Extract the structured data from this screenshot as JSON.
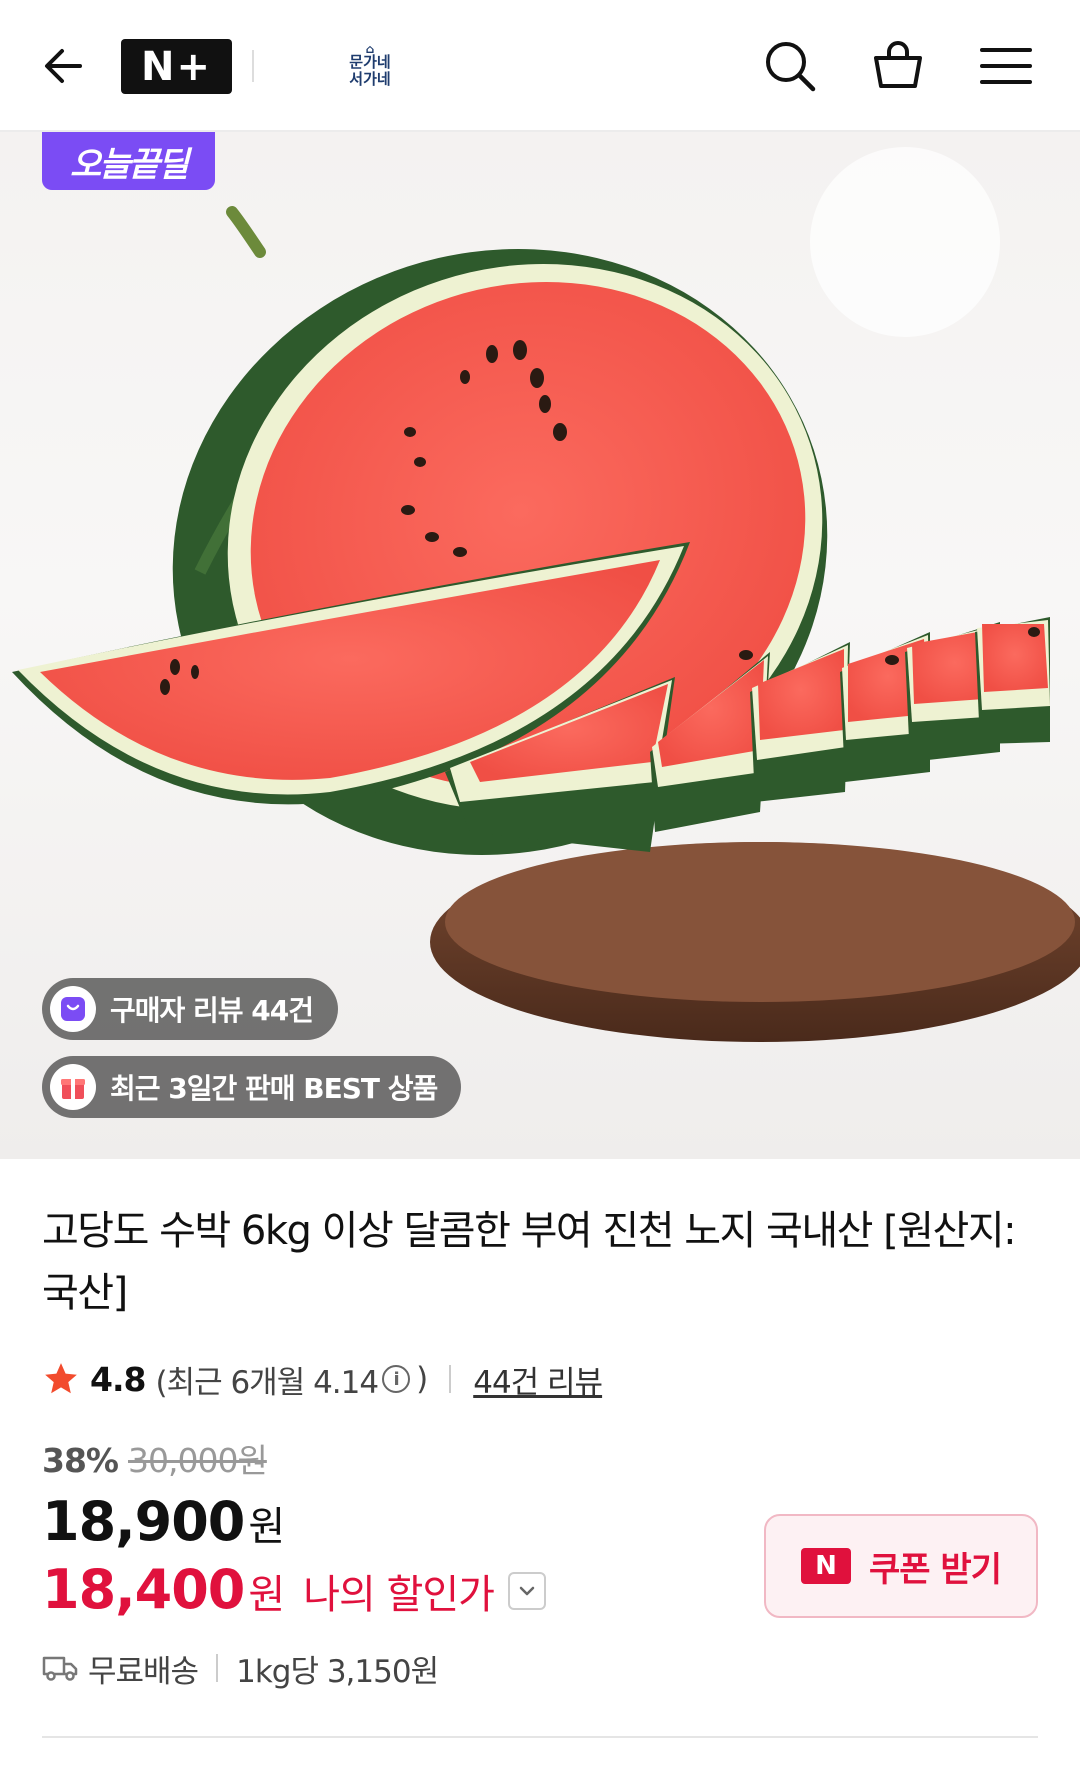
{
  "header": {
    "back_icon": "arrow-left-icon",
    "brand_badge": "N+",
    "store_logo_line1": "문가네",
    "store_logo_line2": "서가네",
    "icons": [
      "search-icon",
      "shopping-bag-icon",
      "menu-icon"
    ]
  },
  "hero": {
    "deal_badge": "오늘끝딜",
    "review_pill": "구매자 리뷰 44건",
    "best_pill": "최근 3일간 판매 BEST 상품"
  },
  "product": {
    "title": "고당도 수박 6kg 이상 달콤한 부여 진천 노지 국내산 [원산지:국산]",
    "rating_score": "4.8",
    "rating_detail_open": "(최근 6개월 4.14",
    "rating_detail_close": ")",
    "review_link": "44건 리뷰",
    "discount_rate": "38%",
    "original_price": "30,000원",
    "price": "18,900",
    "price_unit": "원",
    "my_price": "18,400",
    "my_price_unit": "원",
    "my_price_label": "나의 할인가",
    "coupon_logo": "N",
    "coupon_label": "쿠폰 받기",
    "shipping": "무료배송",
    "unit_price": "1kg당 3,150원"
  },
  "colors": {
    "accent_red": "#e0113d",
    "deal_purple": "#7b4cf4"
  }
}
